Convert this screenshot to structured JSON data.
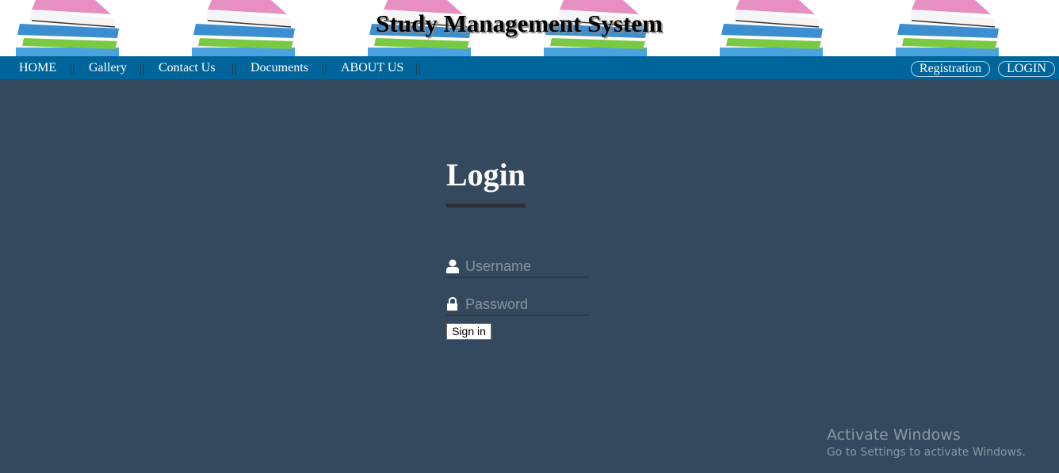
{
  "header": {
    "title": "Study Management System",
    "book_stacks": [
      0,
      1,
      2,
      3,
      4,
      5
    ]
  },
  "nav": {
    "items": [
      {
        "label": "HOME"
      },
      {
        "label": "Gallery"
      },
      {
        "label": "Contact Us"
      },
      {
        "label": "Documents"
      },
      {
        "label": "ABOUT US"
      }
    ],
    "separator": "||",
    "registration_label": "Registration",
    "login_label": "LOGIN"
  },
  "login": {
    "title": "Login",
    "username": {
      "placeholder": "Username",
      "value": "",
      "icon": "user-icon"
    },
    "password": {
      "placeholder": "Password",
      "value": "",
      "icon": "lock-icon"
    },
    "signin_label": "Sign in"
  },
  "watermark": {
    "title": "Activate Windows",
    "subtitle": "Go to Settings to activate Windows."
  },
  "colors": {
    "background": "#34495e",
    "nav": "#00659b",
    "banner": "#ffffff"
  }
}
